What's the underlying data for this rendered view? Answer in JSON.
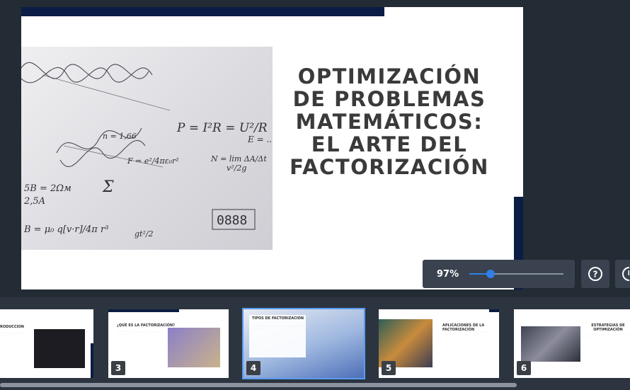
{
  "slide": {
    "title": "OPTIMIZACIÓN DE PROBLEMAS MATEMÁTICOS: EL ARTE DEL FACTORIZACIÓN",
    "formulas": [
      "P = I²R = U²/R",
      "v²/2g",
      "E = ...",
      "N = lim ΔA/Δt",
      "F = e²/4πε₀r²",
      "n = 1,66",
      "5B = 2Ωм",
      "2,5A",
      "B = μ₀ q[v·r]/4π r³",
      "Σ",
      "gt²/2",
      "0888"
    ]
  },
  "zoom": {
    "label": "97%",
    "value": 0.97
  },
  "buttons": {
    "help_icon": "help-icon",
    "notes_icon": "notes-icon"
  },
  "thumbnails": [
    {
      "number": "",
      "title": "RODUCCION"
    },
    {
      "number": "3",
      "title": "¿QUÉ ES LA FACTORIZACIÓN?"
    },
    {
      "number": "4",
      "title": "TIPOS DE FACTORIZACIÓN"
    },
    {
      "number": "5",
      "title": "APLICACIONES DE LA FACTORIZACIÓN"
    },
    {
      "number": "6",
      "title": "ESTRATEGIAS DE OPTIMIZACIÓN"
    }
  ]
}
